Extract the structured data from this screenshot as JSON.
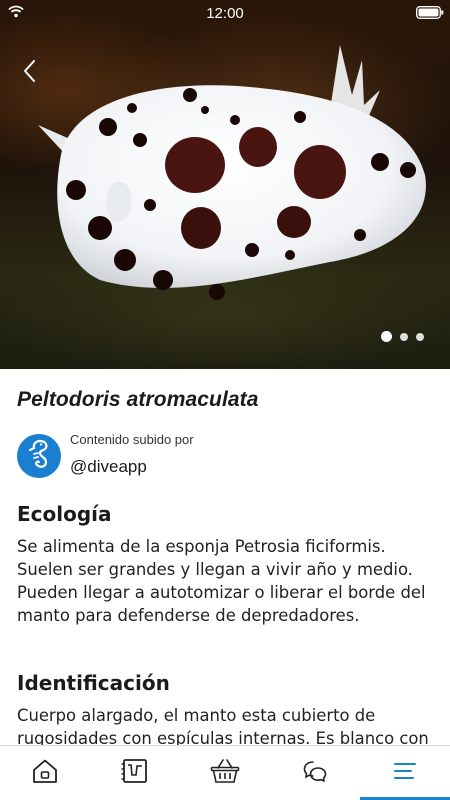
{
  "status_bar": {
    "time": "12:00"
  },
  "hero": {
    "image_icon": "nudibranch-photo",
    "back_icon": "chevron-left-icon",
    "carousel": {
      "total": 3,
      "active": 1
    }
  },
  "species": {
    "name": "Peltodoris atromaculata"
  },
  "uploader": {
    "label": "Contenido subido por",
    "handle": "@diveapp",
    "avatar_icon": "seahorse-icon",
    "avatar_color": "#1a7fd0"
  },
  "sections": [
    {
      "title": "Ecología",
      "text": "Se alimenta de la esponja Petrosia ficiformis. Suelen ser grandes y llegan a vivir año y medio. Pueden llegar a autotomizar o liberar el borde del manto para defenderse de depredadores."
    },
    {
      "title": "Identificación",
      "text": "Cuerpo alargado, el manto esta cubierto de rugosidades con espículas internas. Es blanco con"
    }
  ],
  "tab_bar": {
    "items": [
      {
        "icon": "home-icon"
      },
      {
        "icon": "logbook-icon"
      },
      {
        "icon": "basket-icon"
      },
      {
        "icon": "chat-icon"
      },
      {
        "icon": "menu-icon",
        "active": true
      }
    ],
    "accent_color": "#1a82cf"
  }
}
